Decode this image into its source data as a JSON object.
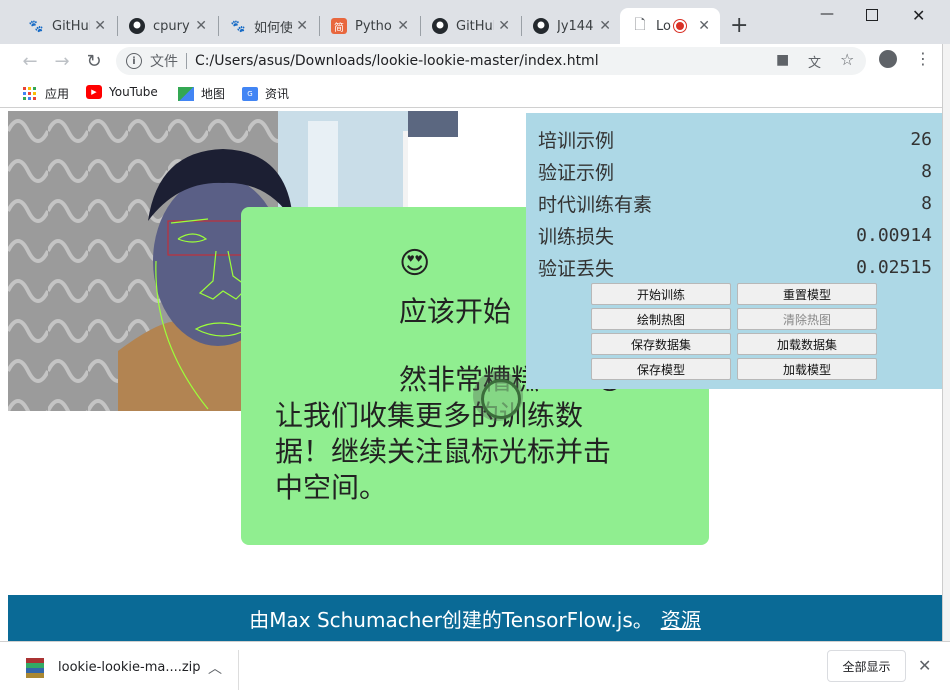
{
  "tabs": [
    {
      "title": "GitHub",
      "icon": "paw-icon",
      "color": "#2f6fd8"
    },
    {
      "title": "cpury",
      "icon": "github-icon",
      "color": "#24292e"
    },
    {
      "title": "如何使",
      "icon": "paw-icon",
      "color": "#2f6fd8"
    },
    {
      "title": "Python",
      "icon": "jian-icon",
      "color": "#e8673e"
    },
    {
      "title": "GitHub",
      "icon": "github-icon",
      "color": "#24292e"
    },
    {
      "title": "Jy144",
      "icon": "github-icon",
      "color": "#24292e"
    },
    {
      "title": "Lo",
      "icon": "page-icon",
      "color": "#5f6368"
    }
  ],
  "omnibox": {
    "scheme_label": "文件",
    "url": "C:/Users/asus/Downloads/lookie-lookie-master/index.html"
  },
  "bookmarks": [
    {
      "label": "应用",
      "icon": "apps-grid-icon"
    },
    {
      "label": "YouTube",
      "icon": "youtube-icon"
    },
    {
      "label": "地图",
      "icon": "maps-icon"
    },
    {
      "label": "资讯",
      "icon": "news-icon"
    }
  ],
  "card": {
    "emoji_line": "😍",
    "line1": "应该开始",
    "line2": "然非常糟糕……😕",
    "line3": "让我们收集更多的训练数",
    "line4": "据！继续关注鼠标光标并击",
    "line5": "中空间。"
  },
  "stats": [
    {
      "label": "培训示例",
      "value": "26"
    },
    {
      "label": "验证示例",
      "value": "8"
    },
    {
      "label": "时代训练有素",
      "value": "8"
    },
    {
      "label": "训练损失",
      "value": "0.00914"
    },
    {
      "label": "验证丢失",
      "value": "0.02515"
    }
  ],
  "buttons": {
    "start_training": "开始训练",
    "reset_model": "重置模型",
    "draw_heatmap": "绘制热图",
    "clear_heatmap": "清除热图",
    "save_dataset": "保存数据集",
    "load_dataset": "加载数据集",
    "save_model": "保存模型",
    "load_model": "加载模型"
  },
  "footer": {
    "text": "由Max Schumacher创建的TensorFlow.js。",
    "link": "资源"
  },
  "download": {
    "filename": "lookie-lookie-ma....zip",
    "show_all": "全部显示"
  },
  "colors": {
    "card_bg": "#90ee90",
    "stats_bg": "#add8e6",
    "footer_bg": "#0a6a96"
  }
}
